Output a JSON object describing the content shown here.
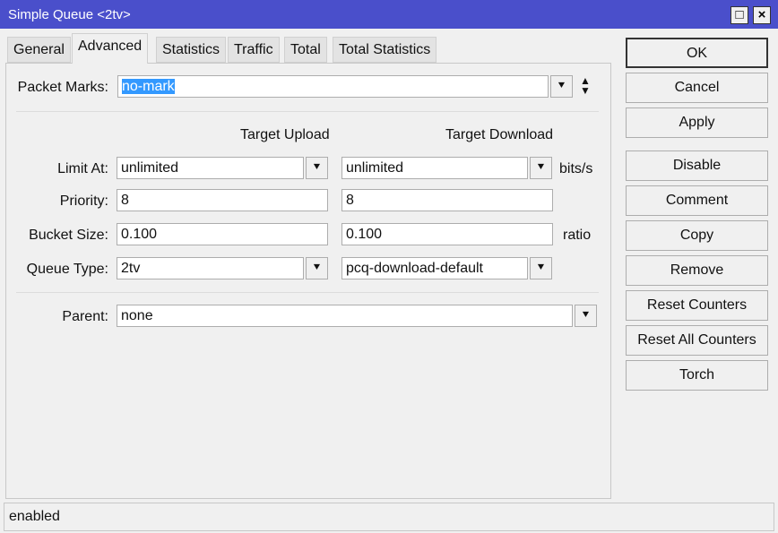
{
  "window": {
    "title": "Simple Queue <2tv>",
    "maximize": "□",
    "close": "×"
  },
  "tabs": [
    "General",
    "Advanced",
    "Statistics",
    "Traffic",
    "Total",
    "Total Statistics"
  ],
  "packet_marks": {
    "label": "Packet Marks:",
    "value": "no-mark"
  },
  "columns": {
    "upload": "Target Upload",
    "download": "Target Download"
  },
  "rows": [
    {
      "label": "Limit At:",
      "upload": "unlimited",
      "download": "unlimited",
      "unit": "bits/s"
    },
    {
      "label": "Priority:",
      "upload": "8",
      "download": "8",
      "unit": ""
    },
    {
      "label": "Bucket Size:",
      "upload": "0.100",
      "download": "0.100",
      "unit": "ratio"
    },
    {
      "label": "Queue Type:",
      "upload": "2tv",
      "download": "pcq-download-default",
      "unit": ""
    }
  ],
  "parent": {
    "label": "Parent:",
    "value": "none"
  },
  "buttons": [
    "OK",
    "Cancel",
    "Apply",
    "Disable",
    "Comment",
    "Copy",
    "Remove",
    "Reset Counters",
    "Reset All Counters",
    "Torch"
  ],
  "status": "enabled"
}
